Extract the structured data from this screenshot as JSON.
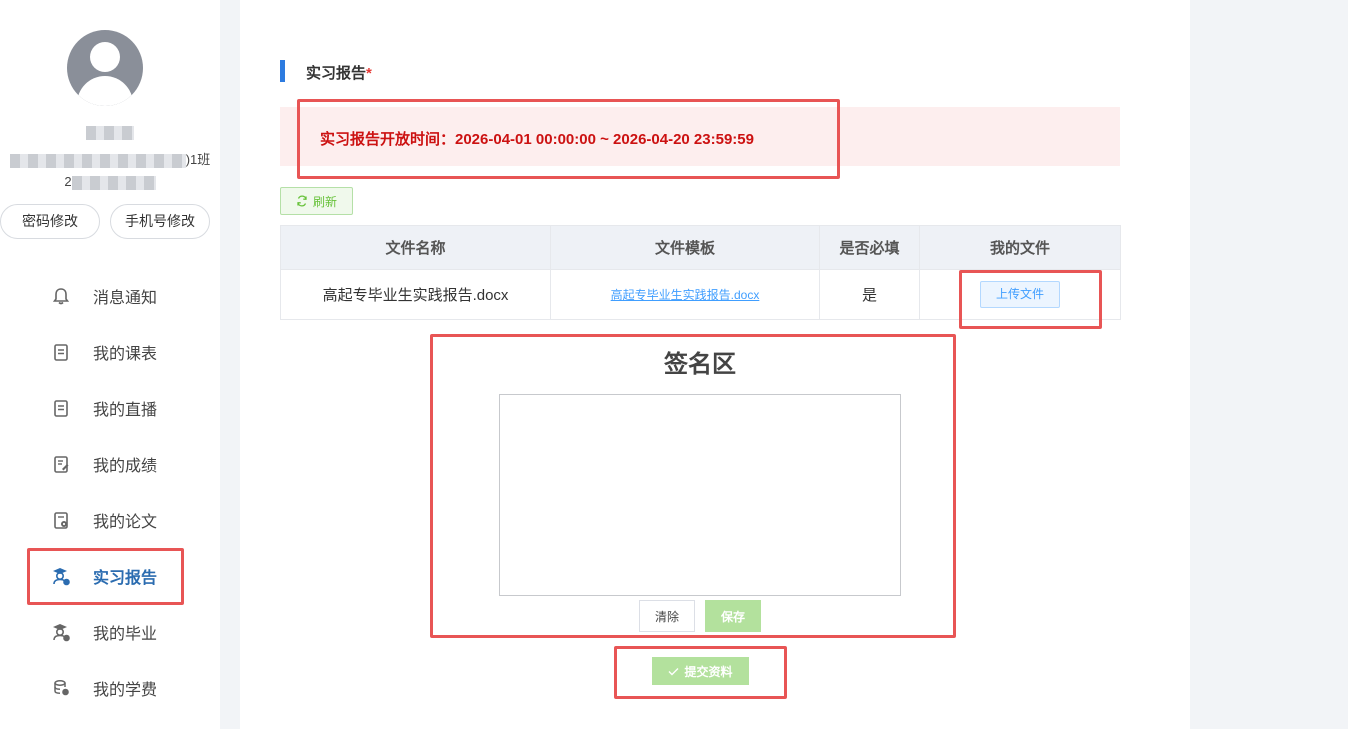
{
  "sidebar": {
    "user": {
      "name_suffix": "",
      "class_suffix": ")1班",
      "id_prefix": "2"
    },
    "buttons": {
      "password": "密码修改",
      "phone": "手机号修改"
    },
    "nav": [
      {
        "label": "消息通知",
        "icon": "bell-icon"
      },
      {
        "label": "我的课表",
        "icon": "document-icon"
      },
      {
        "label": "我的直播",
        "icon": "document-icon"
      },
      {
        "label": "我的成绩",
        "icon": "report-edit-icon"
      },
      {
        "label": "我的论文",
        "icon": "paper-settings-icon"
      },
      {
        "label": "实习报告",
        "icon": "graduate-user-icon"
      },
      {
        "label": "我的毕业",
        "icon": "graduate-cap-icon"
      },
      {
        "label": "我的学费",
        "icon": "coins-icon"
      }
    ],
    "active_index": 5
  },
  "main": {
    "section_title": "实习报告",
    "required_mark": "*",
    "notice": "实习报告开放时间：2026-04-01 00:00:00 ~ 2026-04-20 23:59:59",
    "refresh_label": "刷新",
    "table": {
      "headers": [
        "文件名称",
        "文件模板",
        "是否必填",
        "我的文件"
      ],
      "rows": [
        {
          "name": "高起专毕业生实践报告.docx",
          "template": "高起专毕业生实践报告.docx",
          "required": "是",
          "action": "上传文件"
        }
      ]
    },
    "signature": {
      "title": "签名区",
      "clear_label": "清除",
      "save_label": "保存"
    },
    "submit_label": "提交资料"
  },
  "colors": {
    "accent": "#2d7be0",
    "notice_bg": "#fdeeee",
    "notice_text": "#cc1111",
    "success": "#67c23a",
    "success_light": "#b3e19d",
    "annotation": "#e85555"
  }
}
